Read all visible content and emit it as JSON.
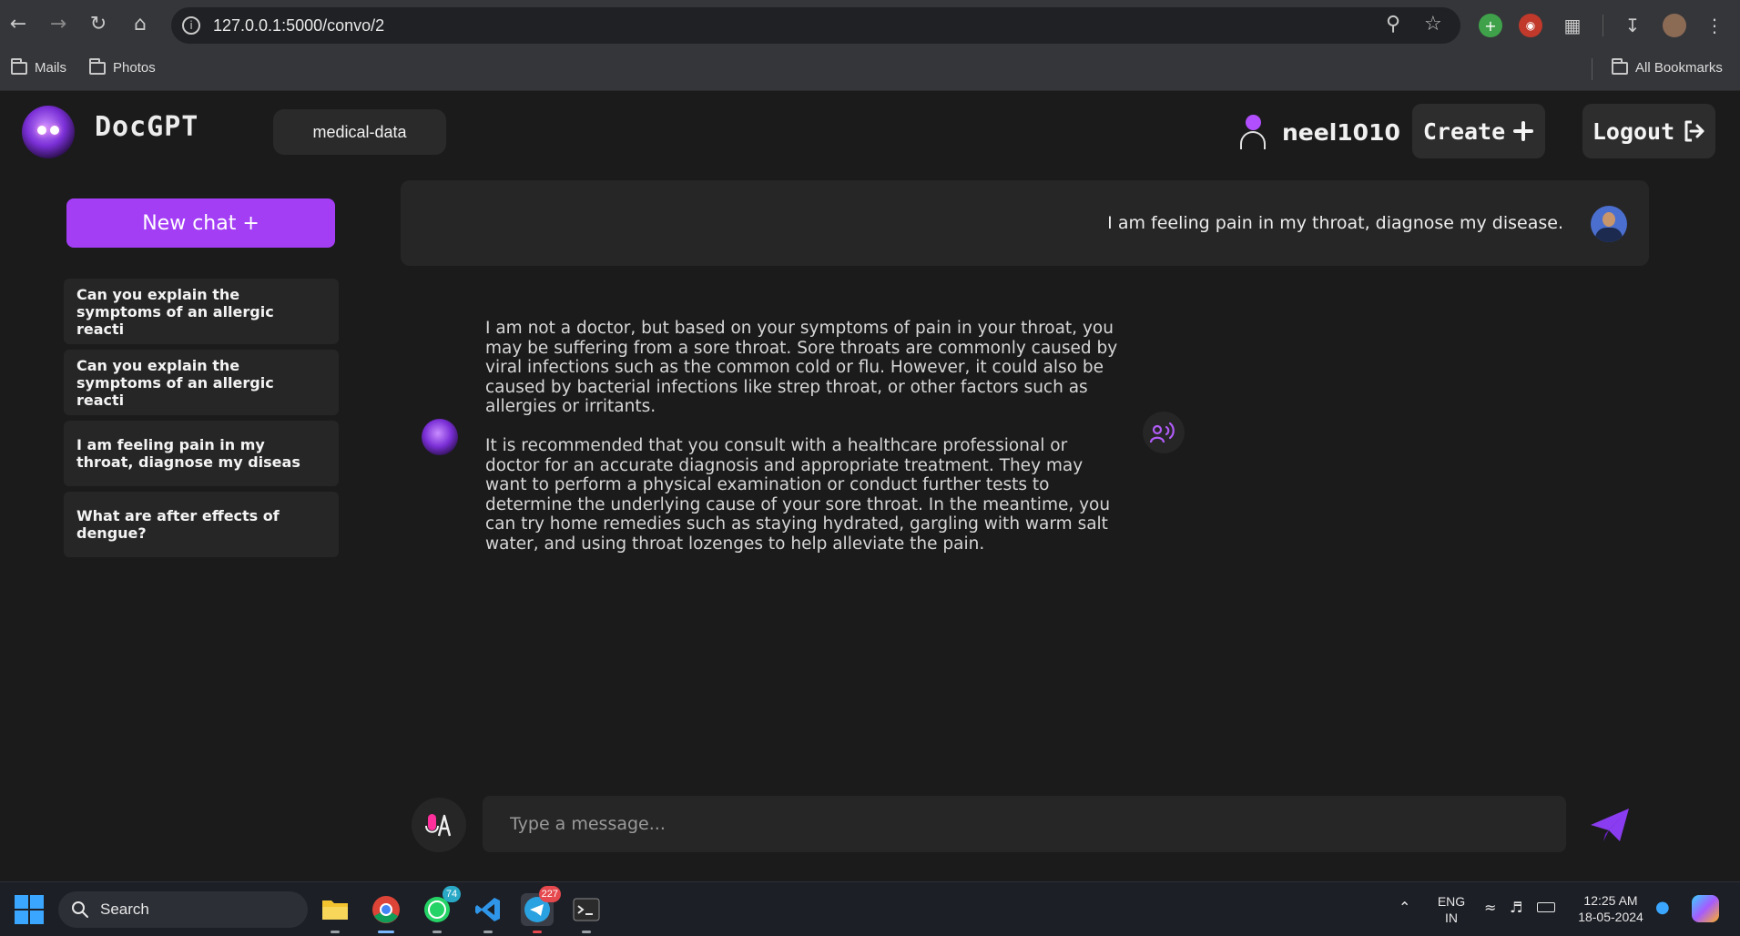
{
  "browser": {
    "url": "127.0.0.1:5000/convo/2",
    "bookmarks": [
      {
        "label": "Mails"
      },
      {
        "label": "Photos"
      }
    ],
    "all_bookmarks_label": "All Bookmarks"
  },
  "header": {
    "brand": "DocGPT",
    "dataset": "medical-data",
    "username": "neel1010",
    "create_label": "Create",
    "logout_label": "Logout"
  },
  "sidebar": {
    "new_chat_label": "New chat +",
    "history": [
      {
        "label": "Can you explain the symptoms of an allergic reacti"
      },
      {
        "label": "Can you explain the symptoms of an allergic reacti"
      },
      {
        "label": "I am feeling pain in my throat, diagnose my diseas"
      },
      {
        "label": "What are after effects of dengue?"
      }
    ]
  },
  "chat": {
    "user_message": "I am feeling pain in my throat, diagnose my disease.",
    "bot_paragraphs": [
      "I am not a doctor, but based on your symptoms of pain in your throat, you may be suffering from a sore throat. Sore throats are commonly caused by viral infections such as the common cold or flu. However, it could also be caused by bacterial infections like strep throat, or other factors such as allergies or irritants.",
      "It is recommended that you consult with a healthcare professional or doctor for an accurate diagnosis and appropriate treatment. They may want to perform a physical examination or conduct further tests to determine the underlying cause of your sore throat. In the meantime, you can try home remedies such as staying hydrated, gargling with warm salt water, and using throat lozenges to help alleviate the pain."
    ]
  },
  "composer": {
    "placeholder": "Type a message..."
  },
  "taskbar": {
    "search_label": "Search",
    "whatsapp_badge": "74",
    "telegram_badge": "227",
    "language": "ENG",
    "region": "IN",
    "time": "12:25 AM",
    "date": "18-05-2024"
  },
  "colors": {
    "accent": "#a33ef5",
    "background": "#1b1b1c",
    "panel": "#262627"
  }
}
